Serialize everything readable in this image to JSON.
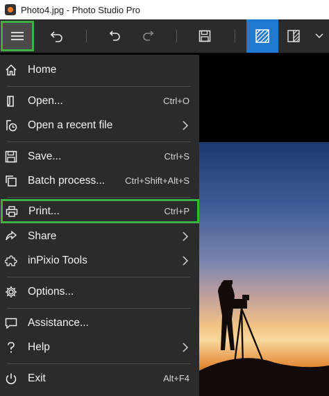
{
  "window": {
    "title": "Photo4.jpg - Photo Studio Pro",
    "accent": "#1f78d1",
    "highlight": "#3cb043"
  },
  "toolbar": {
    "buttons": [
      {
        "name": "menu",
        "icon": "hamburger-icon",
        "highlighted": true
      },
      {
        "name": "back",
        "icon": "back-arrow-icon"
      },
      {
        "name": "undo",
        "icon": "undo-icon"
      },
      {
        "name": "redo",
        "icon": "redo-icon",
        "disabled": true
      },
      {
        "name": "save",
        "icon": "floppy-disk-icon"
      },
      {
        "name": "view-single",
        "icon": "hatched-square-icon",
        "active": true
      },
      {
        "name": "view-compare",
        "icon": "split-view-icon"
      },
      {
        "name": "more",
        "icon": "chevron-down-icon"
      }
    ]
  },
  "menu": {
    "items": [
      {
        "label": "Home",
        "icon": "home-icon"
      },
      {
        "label": "Open...",
        "shortcut": "Ctrl+O",
        "icon": "open-file-icon"
      },
      {
        "label": "Open a recent file",
        "icon": "recent-file-icon",
        "submenu": true
      },
      {
        "label": "Save...",
        "shortcut": "Ctrl+S",
        "icon": "save-icon"
      },
      {
        "label": "Batch process...",
        "shortcut": "Ctrl+Shift+Alt+S",
        "icon": "batch-icon"
      },
      {
        "label": "Print...",
        "shortcut": "Ctrl+P",
        "icon": "printer-icon",
        "highlighted": true
      },
      {
        "label": "Share",
        "icon": "share-icon",
        "submenu": true
      },
      {
        "label": "inPixio Tools",
        "icon": "puzzle-icon",
        "submenu": true
      },
      {
        "label": "Options...",
        "icon": "gear-icon"
      },
      {
        "label": "Assistance...",
        "icon": "chat-icon"
      },
      {
        "label": "Help",
        "icon": "question-icon",
        "submenu": true
      },
      {
        "label": "Exit",
        "shortcut": "Alt+F4",
        "icon": "power-icon"
      }
    ]
  }
}
